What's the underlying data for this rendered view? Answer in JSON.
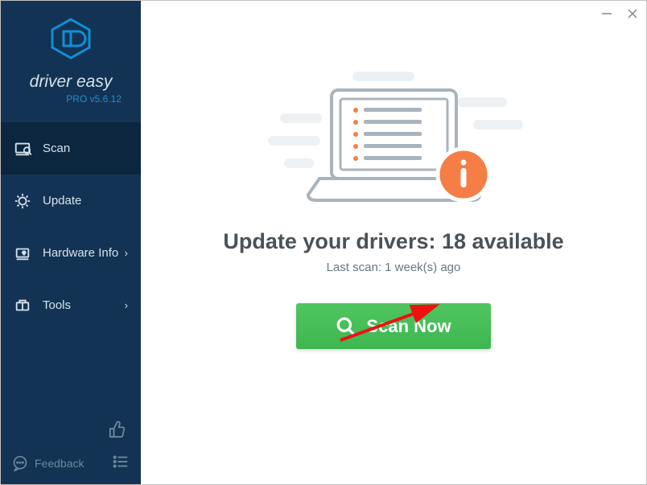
{
  "brand": {
    "name": "driver easy",
    "version_prefix": "PRO v",
    "version": "5.6.12"
  },
  "sidebar": {
    "items": [
      {
        "label": "Scan",
        "has_sub": false
      },
      {
        "label": "Update",
        "has_sub": false
      },
      {
        "label": "Hardware Info",
        "has_sub": true
      },
      {
        "label": "Tools",
        "has_sub": true
      }
    ],
    "feedback_label": "Feedback"
  },
  "main": {
    "headline_prefix": "Update your drivers: ",
    "available_count": 18,
    "headline_suffix": " available",
    "last_scan_prefix": "Last scan: ",
    "last_scan_value": "1 week(s) ago",
    "scan_button_label": "Scan Now"
  },
  "colors": {
    "sidebar_bg": "#123354",
    "accent_green": "#4fc65f",
    "accent_orange": "#f47e46",
    "brand_blue": "#0f8fd6"
  }
}
